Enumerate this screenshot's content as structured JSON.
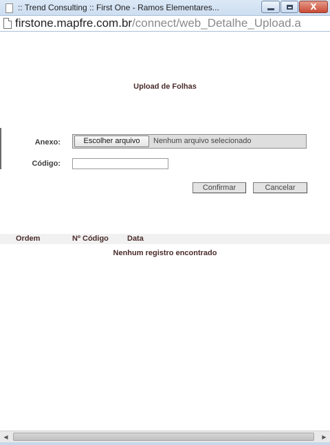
{
  "window": {
    "title": ":: Trend Consulting :: First One - Ramos Elementares...",
    "close_glyph": "X"
  },
  "address": {
    "host": "firstone.mapfre.com.br",
    "path": "/connect/web_Detalhe_Upload.a"
  },
  "page": {
    "title": "Upload de Folhas",
    "anexo_label": "Anexo:",
    "codigo_label": "Código:",
    "file_button": "Escolher arquivo",
    "file_status": "Nenhum arquivo selecionado",
    "codigo_value": "",
    "confirm_label": "Confirmar",
    "cancel_label": "Cancelar"
  },
  "table": {
    "headers": [
      "Ordem",
      "Nº Código",
      "Data"
    ],
    "empty_message": "Nenhum registro encontrado"
  },
  "icons": {
    "left_arrow": "◀",
    "right_arrow": "▶"
  }
}
